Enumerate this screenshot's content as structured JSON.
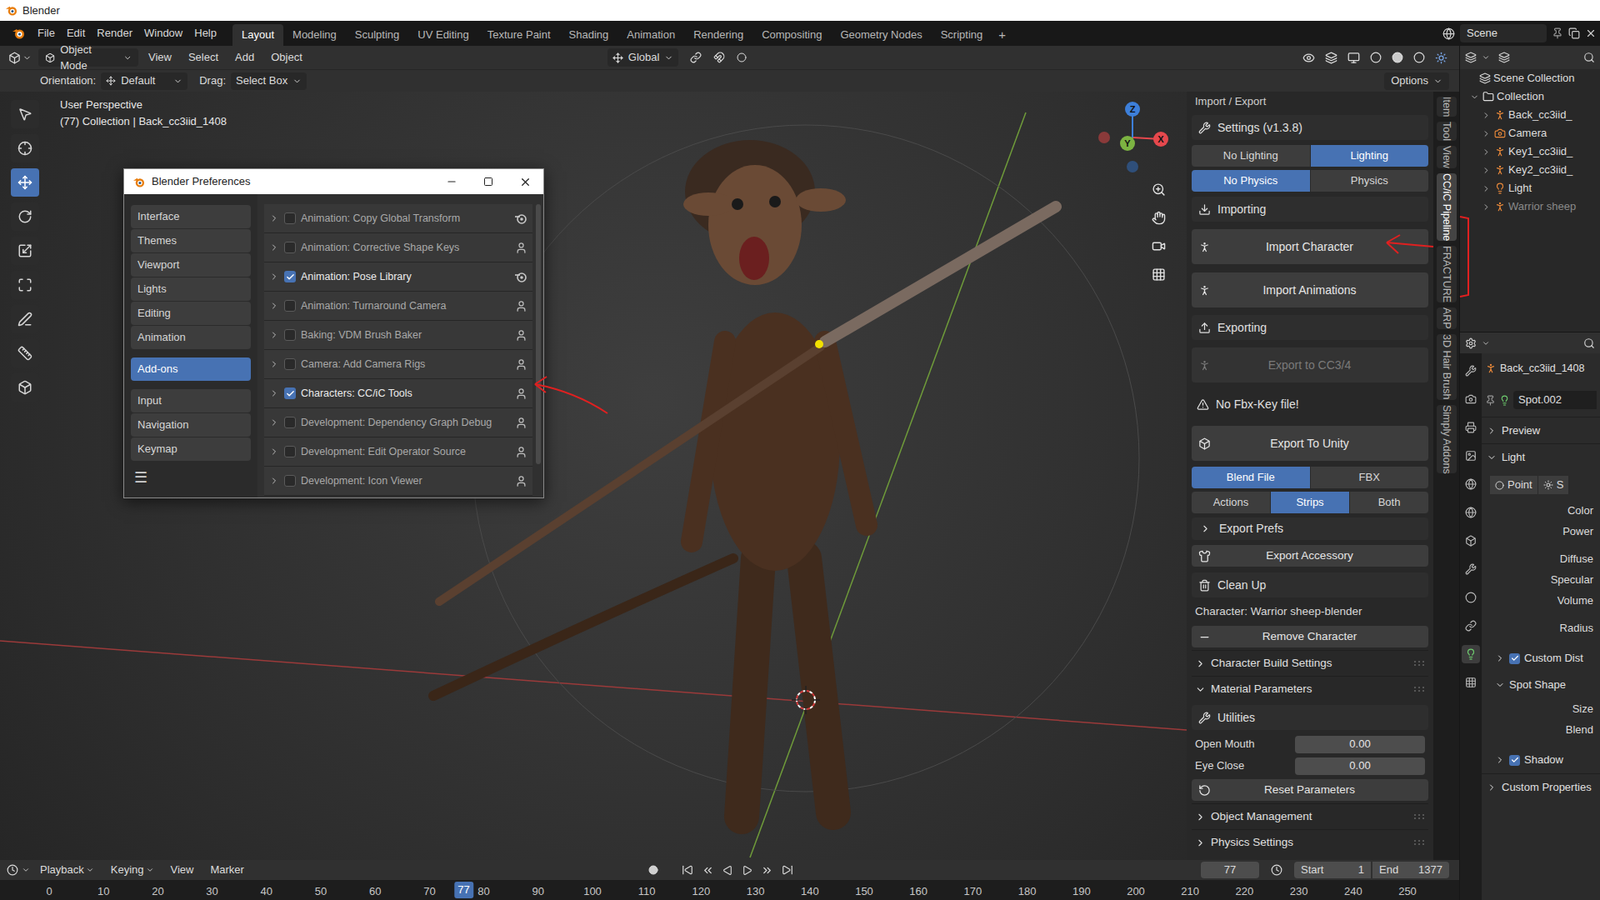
{
  "window": {
    "title": "Blender"
  },
  "menus": [
    "File",
    "Edit",
    "Render",
    "Window",
    "Help"
  ],
  "workspaces": [
    {
      "label": "Layout",
      "selected": true
    },
    {
      "label": "Modeling",
      "selected": false
    },
    {
      "label": "Sculpting",
      "selected": false
    },
    {
      "label": "UV Editing",
      "selected": false
    },
    {
      "label": "Texture Paint",
      "selected": false
    },
    {
      "label": "Shading",
      "selected": false
    },
    {
      "label": "Animation",
      "selected": false
    },
    {
      "label": "Rendering",
      "selected": false
    },
    {
      "label": "Compositing",
      "selected": false
    },
    {
      "label": "Geometry Nodes",
      "selected": false
    },
    {
      "label": "Scripting",
      "selected": false
    }
  ],
  "add_workspace": "+",
  "scene": "Scene",
  "viewport_header": {
    "mode": "Object Mode",
    "menus": [
      "View",
      "Select",
      "Add",
      "Object"
    ],
    "transform_orientation": "Global"
  },
  "tool_settings": {
    "orientation_label": "Orientation:",
    "orientation": "Default",
    "drag_label": "Drag:",
    "drag": "Select Box",
    "options": "Options"
  },
  "tools": [
    {
      "selected": false
    },
    {
      "selected": false
    },
    {
      "selected": true
    },
    {
      "selected": false
    },
    {
      "selected": false
    },
    {
      "selected": false
    },
    {
      "selected": false
    },
    {
      "selected": false
    },
    {
      "selected": false
    }
  ],
  "viewport": {
    "view_name": "User Perspective",
    "context": "(77) Collection | Back_cc3iid_1408",
    "gizmo_axes": [
      {
        "label": "X",
        "color": "#e5484d"
      },
      {
        "label": "Y",
        "color": "#7cb342"
      },
      {
        "label": "Z",
        "color": "#3d7fd9"
      }
    ]
  },
  "preferences": {
    "title": "Blender Preferences",
    "sections": [
      {
        "label": "Interface",
        "selected": false,
        "group": 1
      },
      {
        "label": "Themes",
        "selected": false,
        "group": 1
      },
      {
        "label": "Viewport",
        "selected": false,
        "group": 1
      },
      {
        "label": "Lights",
        "selected": false,
        "group": 1
      },
      {
        "label": "Editing",
        "selected": false,
        "group": 1
      },
      {
        "label": "Animation",
        "selected": false,
        "group": 1
      },
      {
        "label": "Add-ons",
        "selected": true,
        "group": 2
      },
      {
        "label": "Input",
        "selected": false,
        "group": 3
      },
      {
        "label": "Navigation",
        "selected": false,
        "group": 3
      },
      {
        "label": "Keymap",
        "selected": false,
        "group": 3
      }
    ],
    "menu": "☰",
    "addons": [
      {
        "label": "Animation: Copy Global Transform",
        "enabled": false,
        "expanded": false,
        "kind": "official"
      },
      {
        "label": "Animation: Corrective Shape Keys",
        "enabled": false,
        "expanded": false,
        "kind": "community"
      },
      {
        "label": "Animation: Pose Library",
        "enabled": true,
        "expanded": false,
        "kind": "official"
      },
      {
        "label": "Animation: Turnaround Camera",
        "enabled": false,
        "expanded": false,
        "kind": "community"
      },
      {
        "label": "Baking: VDM Brush Baker",
        "enabled": false,
        "expanded": false,
        "kind": "community"
      },
      {
        "label": "Camera: Add Camera Rigs",
        "enabled": false,
        "expanded": false,
        "kind": "community"
      },
      {
        "label": "Characters: CC/iC Tools",
        "enabled": true,
        "expanded": false,
        "kind": "community"
      },
      {
        "label": "Development: Dependency Graph Debug",
        "enabled": false,
        "expanded": false,
        "kind": "community"
      },
      {
        "label": "Development: Edit Operator Source",
        "enabled": false,
        "expanded": false,
        "kind": "community"
      },
      {
        "label": "Development: Icon Viewer",
        "enabled": false,
        "expanded": false,
        "kind": "community"
      }
    ]
  },
  "n_panel": {
    "tabs": [
      {
        "label": "Item",
        "selected": false
      },
      {
        "label": "Tool",
        "selected": false
      },
      {
        "label": "View",
        "selected": false
      },
      {
        "label": "CC/iC Pipeline",
        "selected": true
      },
      {
        "label": "FRACTURE",
        "selected": false
      },
      {
        "label": "ARP",
        "selected": false
      },
      {
        "label": "3D Hair Brush",
        "selected": false
      },
      {
        "label": "Simply Addons",
        "selected": false
      }
    ],
    "rows": [
      {
        "kind": "header",
        "label": "Import / Export"
      },
      {
        "kind": "heading",
        "label": "Settings (v1.3.8)"
      },
      {
        "kind": "toggle",
        "options": [
          {
            "label": "No Lighting",
            "selected": false
          },
          {
            "label": "Lighting",
            "selected": true
          }
        ]
      },
      {
        "kind": "toggle",
        "options": [
          {
            "label": "No Physics",
            "selected": true
          },
          {
            "label": "Physics",
            "selected": false
          }
        ]
      },
      {
        "kind": "heading",
        "label": "Importing"
      },
      {
        "kind": "big_button",
        "label": "Import Character",
        "disabled": false
      },
      {
        "kind": "big_button",
        "label": "Import Animations",
        "disabled": false
      },
      {
        "kind": "heading",
        "label": "Exporting"
      },
      {
        "kind": "big_button",
        "label": "Export to CC3/4",
        "disabled": true
      },
      {
        "kind": "warning",
        "label": "No Fbx-Key file!"
      },
      {
        "kind": "big_button",
        "label": "Export To Unity",
        "disabled": false
      },
      {
        "kind": "toggle",
        "options": [
          {
            "label": "Blend File",
            "selected": true
          },
          {
            "label": "FBX",
            "selected": false
          }
        ]
      },
      {
        "kind": "toggle",
        "options": [
          {
            "label": "Actions",
            "selected": false
          },
          {
            "label": "Strips",
            "selected": true
          },
          {
            "label": "Both",
            "selected": false
          }
        ]
      },
      {
        "kind": "subpanel",
        "label": "Export Prefs",
        "expanded": false
      },
      {
        "kind": "button",
        "label": "Export Accessory"
      },
      {
        "kind": "heading",
        "label": "Clean Up"
      },
      {
        "kind": "label",
        "label": "Character: Warrior sheep-blender"
      },
      {
        "kind": "button",
        "label": "Remove Character"
      },
      {
        "kind": "section",
        "label": "Character Build Settings",
        "expanded": false
      },
      {
        "kind": "section",
        "label": "Material Parameters",
        "expanded": true
      },
      {
        "kind": "heading",
        "label": "Utilities"
      },
      {
        "kind": "field",
        "label": "Open Mouth",
        "value": "0.00"
      },
      {
        "kind": "field",
        "label": "Eye Close",
        "value": "0.00"
      },
      {
        "kind": "button",
        "label": "Reset Parameters"
      },
      {
        "kind": "section",
        "label": "Object Management",
        "expanded": false
      },
      {
        "kind": "section",
        "label": "Physics Settings",
        "expanded": false
      }
    ]
  },
  "outliner": {
    "items": [
      {
        "label": "Scene Collection",
        "depth": 0,
        "kind": "scene",
        "dimmed": false
      },
      {
        "label": "Collection",
        "depth": 1,
        "kind": "collection",
        "expanded": true,
        "dimmed": false
      },
      {
        "label": "Back_cc3iid_",
        "depth": 2,
        "kind": "armature",
        "expanded": false,
        "dimmed": false
      },
      {
        "label": "Camera",
        "depth": 2,
        "kind": "camera",
        "expanded": false,
        "dimmed": false
      },
      {
        "label": "Key1_cc3iid_",
        "depth": 2,
        "kind": "armature",
        "expanded": false,
        "dimmed": false
      },
      {
        "label": "Key2_cc3iid_",
        "depth": 2,
        "kind": "armature",
        "expanded": false,
        "dimmed": false
      },
      {
        "label": "Light",
        "depth": 2,
        "kind": "light",
        "expanded": false,
        "dimmed": false
      },
      {
        "label": "Warrior sheep",
        "depth": 2,
        "kind": "armature",
        "expanded": false,
        "dimmed": true
      }
    ]
  },
  "properties": {
    "tabs": [
      {
        "selected": false
      },
      {
        "selected": false
      },
      {
        "selected": false
      },
      {
        "selected": false
      },
      {
        "selected": false
      },
      {
        "selected": false
      },
      {
        "selected": false
      },
      {
        "selected": false
      },
      {
        "selected": false
      },
      {
        "selected": false
      },
      {
        "selected": true
      },
      {
        "selected": false
      }
    ],
    "object": "Back_cc3iid_1408",
    "data": "Spot.002",
    "rows": [
      {
        "kind": "panel",
        "label": "Preview",
        "expanded": false
      },
      {
        "kind": "panel",
        "label": "Light",
        "expanded": true
      },
      {
        "kind": "type",
        "options": [
          {
            "label": "Point",
            "selected": false
          },
          {
            "label": "S",
            "selected": false
          }
        ]
      },
      {
        "kind": "fields",
        "labels": [
          "Color",
          "Power"
        ]
      },
      {
        "kind": "fields",
        "labels": [
          "Diffuse",
          "Specular",
          "Volume"
        ]
      },
      {
        "kind": "fields",
        "labels": [
          "Radius"
        ]
      },
      {
        "kind": "subpanel",
        "label": "Custom Dist",
        "checked": true,
        "expanded": false
      },
      {
        "kind": "subpanel",
        "label": "Spot Shape",
        "expanded": true
      },
      {
        "kind": "fields",
        "labels": [
          "Size",
          "Blend"
        ]
      },
      {
        "kind": "subpanel",
        "label": "Shadow",
        "checked": true,
        "expanded": false
      },
      {
        "kind": "panel",
        "label": "Custom Properties",
        "expanded": false
      }
    ]
  },
  "timeline": {
    "menus": [
      "Playback",
      "Keying",
      "View",
      "Marker"
    ],
    "current_frame": "77",
    "start_label": "Start",
    "start": "1",
    "end_label": "End",
    "end": "1377",
    "ticks": [
      "0",
      "10",
      "20",
      "30",
      "40",
      "50",
      "60",
      "70",
      "80",
      "90",
      "100",
      "110",
      "120",
      "130",
      "140",
      "150",
      "160",
      "170",
      "180",
      "190",
      "200",
      "210",
      "220",
      "230",
      "240",
      "250"
    ]
  }
}
